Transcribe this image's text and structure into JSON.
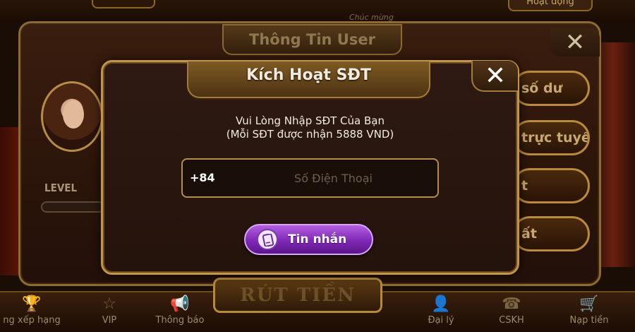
{
  "background": {
    "top_tab_label": "Hoạt động",
    "ticker_text": "Chúc mừng",
    "user_panel": {
      "title": "Thông Tin User",
      "close_glyph": "✕",
      "level_label": "LEVEL",
      "side_buttons": [
        "số dư",
        "trực tuyến",
        "t",
        "ất"
      ]
    },
    "withdraw_label": "RÚT TIỀN"
  },
  "bottom_nav": [
    {
      "label": "ng xếp hạng",
      "icon": "trophy-icon",
      "glyph": "🏆"
    },
    {
      "label": "VIP",
      "icon": "star-icon",
      "glyph": "☆"
    },
    {
      "label": "Thông báo",
      "icon": "megaphone-icon",
      "glyph": "📢"
    },
    {
      "label": "Đại lý",
      "icon": "agent-icon",
      "glyph": "👤"
    },
    {
      "label": "CSKH",
      "icon": "headset-icon",
      "glyph": "☎"
    },
    {
      "label": "Nạp tiền",
      "icon": "cart-icon",
      "glyph": "🛒"
    }
  ],
  "dialog": {
    "title": "Kích Hoạt SĐT",
    "close_glyph": "✕",
    "instruction_line1": "Vui Lòng Nhập SĐT Của Bạn",
    "instruction_line2": "(Mỗi SĐT được nhận 5888 VND)",
    "phone_prefix": "+84",
    "phone_placeholder": "Số Điện Thoại",
    "phone_value": "",
    "sms_button_label": "Tin nhắn"
  },
  "colors": {
    "gold_border": "#c2954a",
    "sms_button": "#9b42d0",
    "panel_bg": "#24130c"
  }
}
